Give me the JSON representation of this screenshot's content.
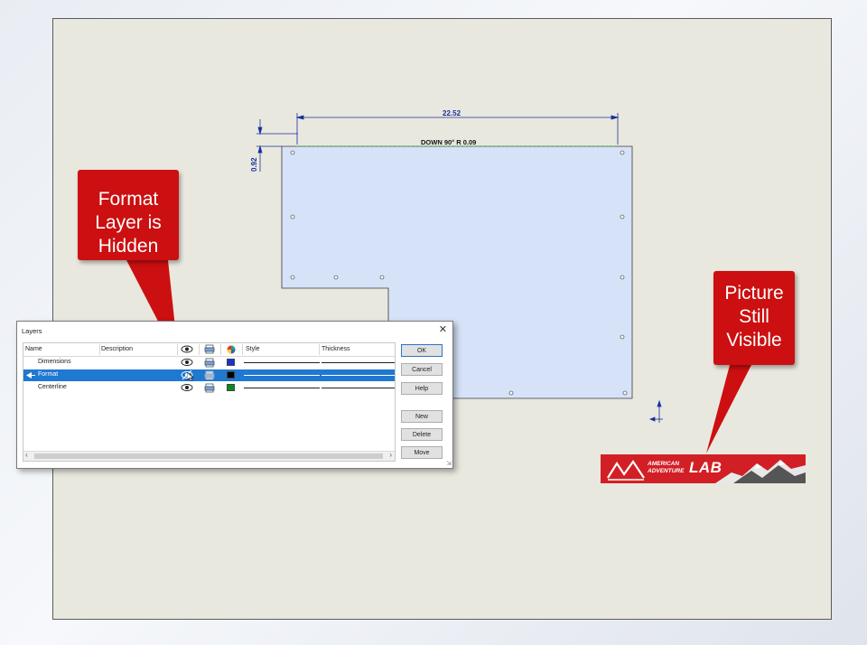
{
  "drawing": {
    "width_dim": "22.52",
    "height_dim": "0.92",
    "bend_note": "DOWN  90°  R 0.09"
  },
  "callouts": {
    "left": [
      "Format",
      "Layer is",
      "Hidden"
    ],
    "right": [
      "Picture",
      "Still",
      "Visible"
    ]
  },
  "logo": {
    "line1": "AMERICAN",
    "line2": "ADVENTURE",
    "big": "LAB"
  },
  "dialog": {
    "title": "Layers",
    "close": "✕",
    "columns": {
      "name": "Name",
      "description": "Description",
      "style": "Style",
      "thickness": "Thickness"
    },
    "rows": [
      {
        "name": "Dimensions",
        "color": "#1d2fd6",
        "visible": true,
        "selected": false
      },
      {
        "name": "Format",
        "color": "#000000",
        "visible": false,
        "selected": true
      },
      {
        "name": "Centerline",
        "color": "#0a8a1e",
        "visible": true,
        "selected": false
      }
    ],
    "buttons": {
      "ok": "OK",
      "cancel": "Cancel",
      "help": "Help",
      "new": "New",
      "delete": "Delete",
      "move": "Move"
    }
  }
}
